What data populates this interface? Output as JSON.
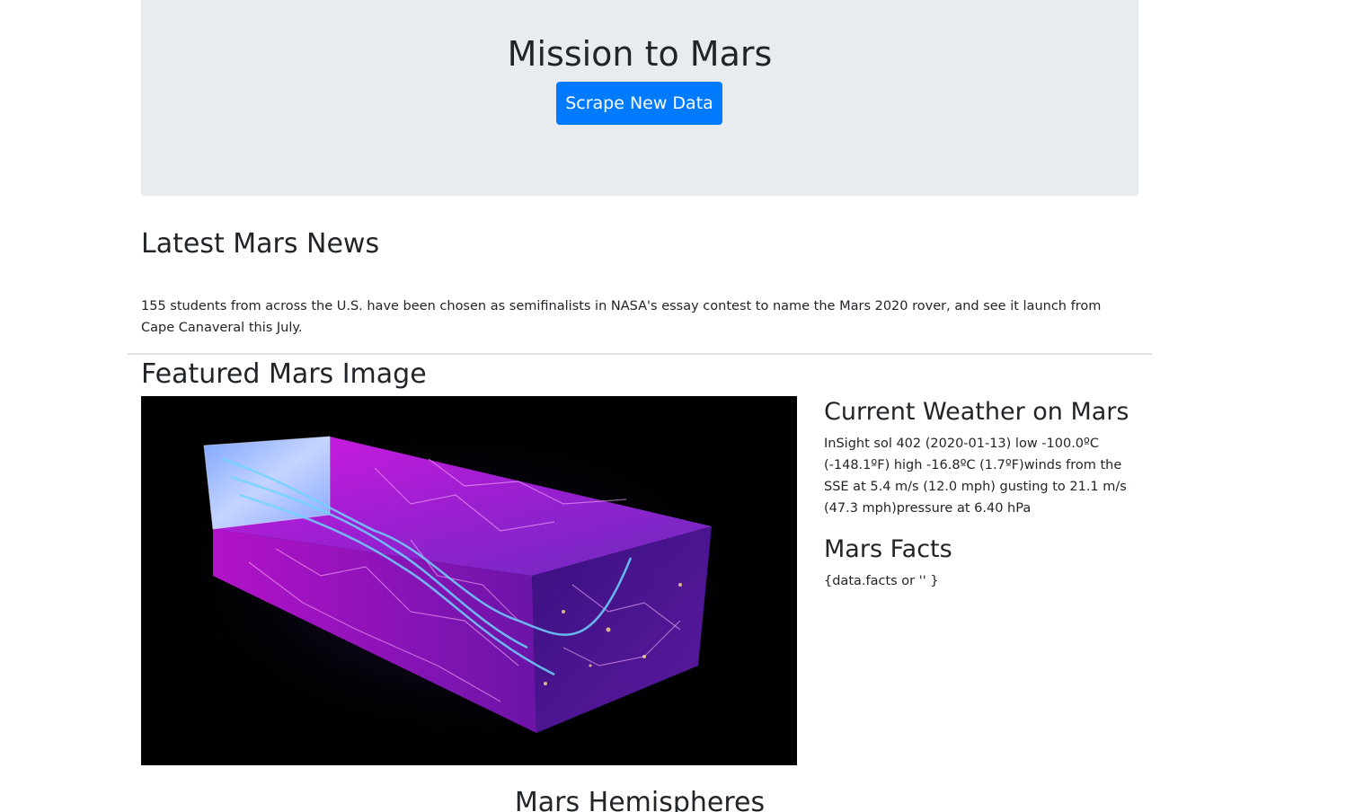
{
  "header": {
    "title": "Mission to Mars",
    "scrape_button_label": "Scrape New Data"
  },
  "news": {
    "heading": "Latest Mars News",
    "paragraph": "155 students from across the U.S. have been chosen as semifinalists in NASA's essay contest to name the Mars 2020 rover, and see it launch from Cape Canaveral this July."
  },
  "featured_image": {
    "heading": "Featured Mars Image"
  },
  "weather": {
    "heading": "Current Weather on Mars",
    "report": "InSight sol 402 (2020-01-13) low -100.0ºC (-148.1ºF) high -16.8ºC (1.7ºF)winds from the SSE at 5.4 m/s (12.0 mph) gusting to 21.1 m/s (47.3 mph)pressure at 6.40 hPa"
  },
  "facts": {
    "heading": "Mars Facts",
    "body": "{data.facts or '' }"
  },
  "hemispheres": {
    "heading": "Mars Hemispheres"
  }
}
